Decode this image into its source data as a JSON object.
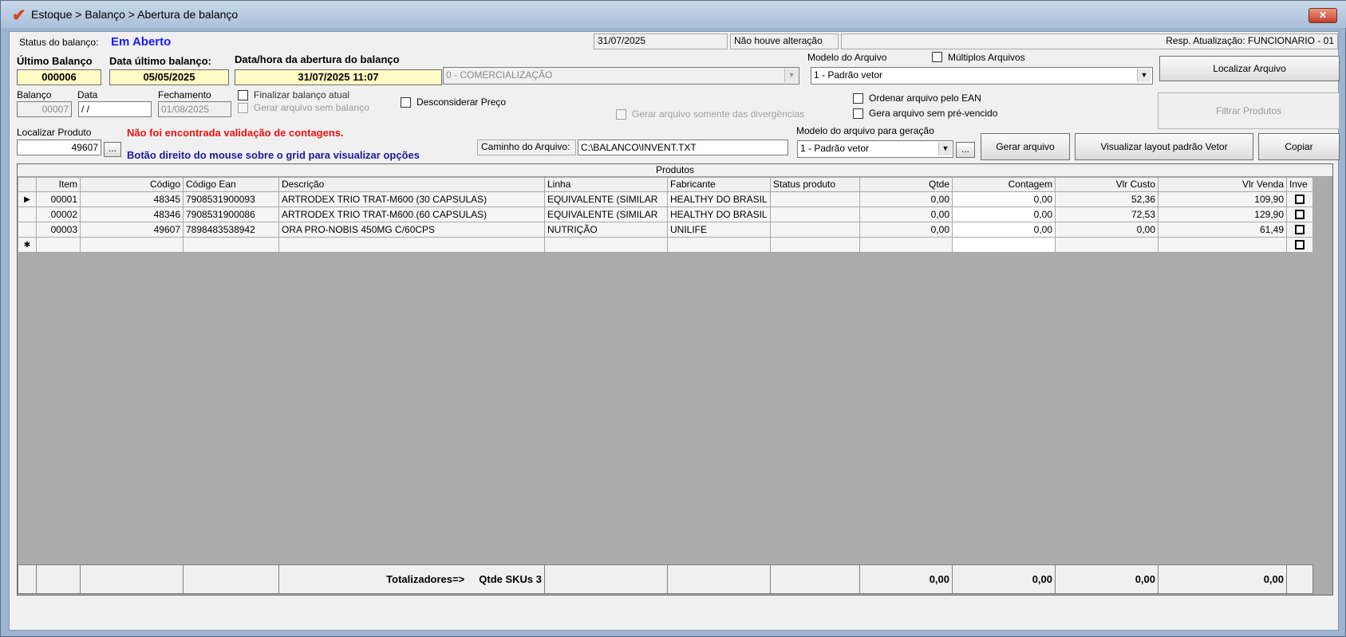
{
  "window": {
    "title": "Estoque > Balanço > Abertura de balanço",
    "close_label": "✕"
  },
  "status": {
    "label": "Status do balanço:",
    "value": "Em Aberto",
    "date": "31/07/2025",
    "change": "Não houve alteração",
    "resp": "Resp. Atualização: FUNCIONARIO - 01"
  },
  "ultimo": {
    "label": "Último Balanço",
    "value": "000006",
    "data_label": "Data último balanço:",
    "data_value": "05/05/2025",
    "abertura_label": "Data/hora da abertura do balanço",
    "abertura_value": "31/07/2025 11:07"
  },
  "tipo_combo": "0 - COMERCIALIZAÇÃO",
  "modelo": {
    "label": "Modelo do Arquivo",
    "value": "1 - Padrão vetor",
    "multiplos": "Múltiplos Arquivos"
  },
  "buttons": {
    "localizar": "Localizar Arquivo",
    "filtrar": "Filtrar Produtos",
    "gerar": "Gerar arquivo",
    "visualizar": "Visualizar layout padrão Vetor",
    "copiar": "Copiar",
    "dots": "..."
  },
  "balanco": {
    "label": "Balanço",
    "value": "00007",
    "data_label": "Data",
    "data_value": " /  /",
    "fechamento_label": "Fechamento",
    "fechamento_value": "01/08/2025"
  },
  "checks": {
    "finalizar": "Finalizar balanço atual",
    "gerar_sem": "Gerar arquivo sem balanço",
    "desconsiderar": "Desconsiderar Preço",
    "somente_div": "Gerar arquivo somente das divergências",
    "ordenar_ean": "Ordenar arquivo pelo EAN",
    "sem_prevenc": "Gera arquivo sem pré-vencido"
  },
  "localizar": {
    "label": "Localizar Produto",
    "value": "49607"
  },
  "messages": {
    "warn": "Não foi encontrada validação de contagens.",
    "hint": "Botão direito do mouse sobre o grid para visualizar opções"
  },
  "caminho": {
    "label": "Caminho do Arquivo:",
    "value": "C:\\BALANCO\\INVENT.TXT"
  },
  "modelo_geracao": {
    "label": "Modelo do arquivo para geração",
    "value": "1 - Padrão vetor"
  },
  "grid": {
    "caption": "Produtos",
    "headers": [
      "Item",
      "Código",
      "Código Ean",
      "Descrição",
      "Linha",
      "Fabricante",
      "Status produto",
      "Qtde",
      "Contagem",
      "Vlr Custo",
      "Vlr Venda",
      "Inve"
    ],
    "rows": [
      {
        "item": "00001",
        "codigo": "48345",
        "ean": "7908531900093",
        "descricao": "ARTRODEX TRIO TRAT-M600 (30 CAPSULAS)",
        "linha": "EQUIVALENTE (SIMILAR",
        "fabricante": "HEALTHY DO BRASIL",
        "status": "",
        "qtde": "0,00",
        "contagem": "0,00",
        "custo": "52,36",
        "venda": "109,90"
      },
      {
        "item": "00002",
        "codigo": "48346",
        "ean": "7908531900086",
        "descricao": "ARTRODEX TRIO TRAT-M600 (60 CAPSULAS)",
        "linha": "EQUIVALENTE (SIMILAR",
        "fabricante": "HEALTHY DO BRASIL",
        "status": "",
        "qtde": "0,00",
        "contagem": "0,00",
        "custo": "72,53",
        "venda": "129,90"
      },
      {
        "item": "00003",
        "codigo": "49607",
        "ean": "7898483538942",
        "descricao": "ORA PRO-NOBIS 450MG C/60CPS",
        "linha": "NUTRIÇÃO",
        "fabricante": "UNILIFE",
        "status": "",
        "qtde": "0,00",
        "contagem": "0,00",
        "custo": "0,00",
        "venda": "61,49"
      }
    ],
    "totals": {
      "label": "Totalizadores=>",
      "skus": "Qtde SKUs 3",
      "qtde": "0,00",
      "contagem": "0,00",
      "custo": "0,00",
      "venda": "0,00"
    }
  }
}
